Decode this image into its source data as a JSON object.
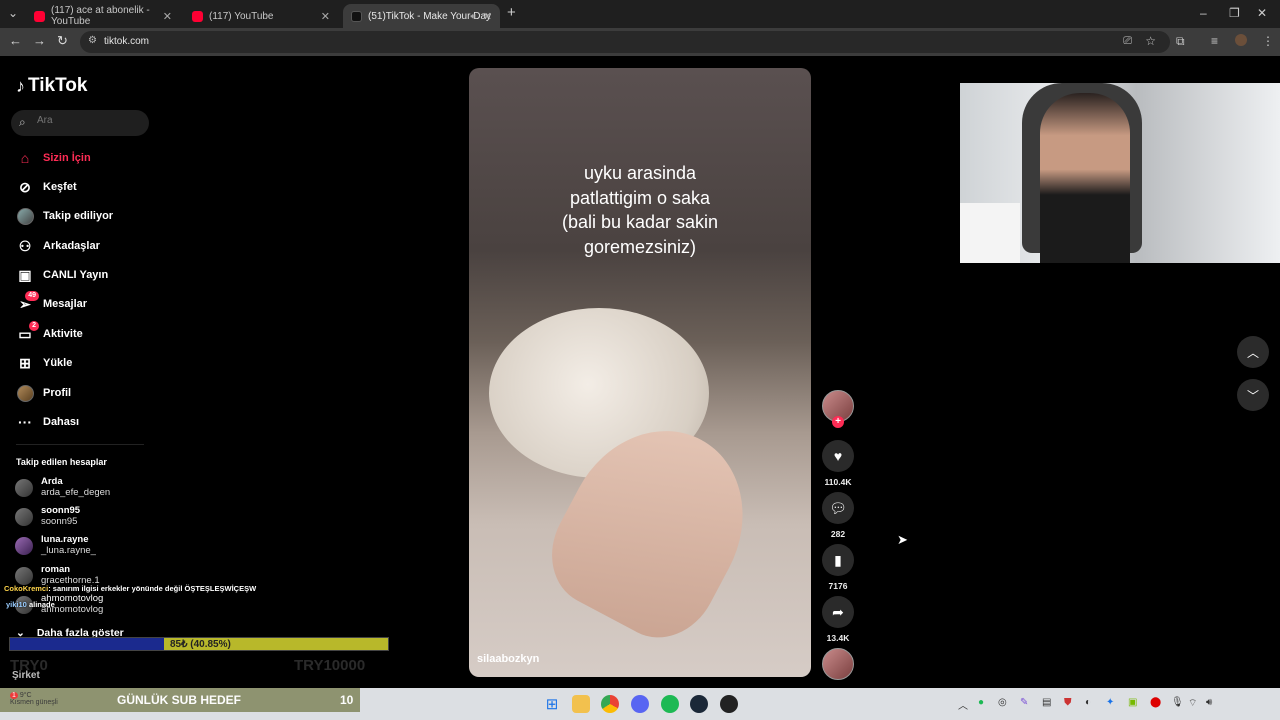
{
  "browser": {
    "tabs": [
      {
        "title": "(117) ace at abonelik - YouTube",
        "favicon": "youtube-icon"
      },
      {
        "title": "(117) YouTube",
        "favicon": "youtube-icon"
      },
      {
        "title": "(51)TikTok - Make Your Day",
        "favicon": "tiktok-icon",
        "active": true
      }
    ],
    "url": "tiktok.com"
  },
  "sidebar": {
    "logo": "TikTok",
    "search_placeholder": "Ara",
    "nav": [
      {
        "label": "Sizin İçin",
        "icon": "home-icon",
        "active": true
      },
      {
        "label": "Keşfet",
        "icon": "compass-icon"
      },
      {
        "label": "Takip ediliyor",
        "icon": "avatar-icon"
      },
      {
        "label": "Arkadaşlar",
        "icon": "friends-icon"
      },
      {
        "label": "CANLI Yayın",
        "icon": "live-icon"
      },
      {
        "label": "Mesajlar",
        "icon": "paper-plane-icon",
        "badge": "49"
      },
      {
        "label": "Aktivite",
        "icon": "inbox-icon",
        "badge": "2"
      },
      {
        "label": "Yükle",
        "icon": "upload-icon"
      },
      {
        "label": "Profil",
        "icon": "profile-icon"
      },
      {
        "label": "Dahası",
        "icon": "more-icon"
      }
    ],
    "following_title": "Takip edilen hesaplar",
    "following": [
      {
        "name": "Arda",
        "handle": "arda_efe_degen"
      },
      {
        "name": "soonn95",
        "handle": "soonn95"
      },
      {
        "name": "luna.rayne",
        "handle": "_luna.rayne_"
      },
      {
        "name": "roman",
        "handle": "gracethorne.1"
      },
      {
        "name": "ahmomotovlog",
        "handle": "ahmomotovlog"
      }
    ],
    "show_more": "Daha fazla göster",
    "company": "Şirket"
  },
  "video": {
    "caption": [
      "uyku arasinda",
      "patlattigim o saka",
      "(bali bu kadar sakin",
      "goremezsiniz)"
    ],
    "author": "silaabozkyn",
    "likes": "110.4K",
    "comments": "282",
    "saves": "7176",
    "shares": "13.4K"
  },
  "overlay": {
    "chat_user": "CokoKremci",
    "chat_message": ": sanırım ilgisi erkekler yönünde değil ÖŞTEŞLEŞWİÇEŞW",
    "chat2_user": "yiki10",
    "chat2_message": "alinade",
    "goal_text": "85₺ (40.85%)",
    "goal_percent": 40.85,
    "goal_min": "TRY0",
    "goal_max": "TRY10000",
    "sub_goal_label": "GÜNLÜK SUB HEDEF",
    "sub_goal_value": "10",
    "weather_temp": "9°C",
    "weather_desc": "Kısmen güneşli",
    "notif_count": "1"
  },
  "colors": {
    "accent": "#fe2c55"
  }
}
